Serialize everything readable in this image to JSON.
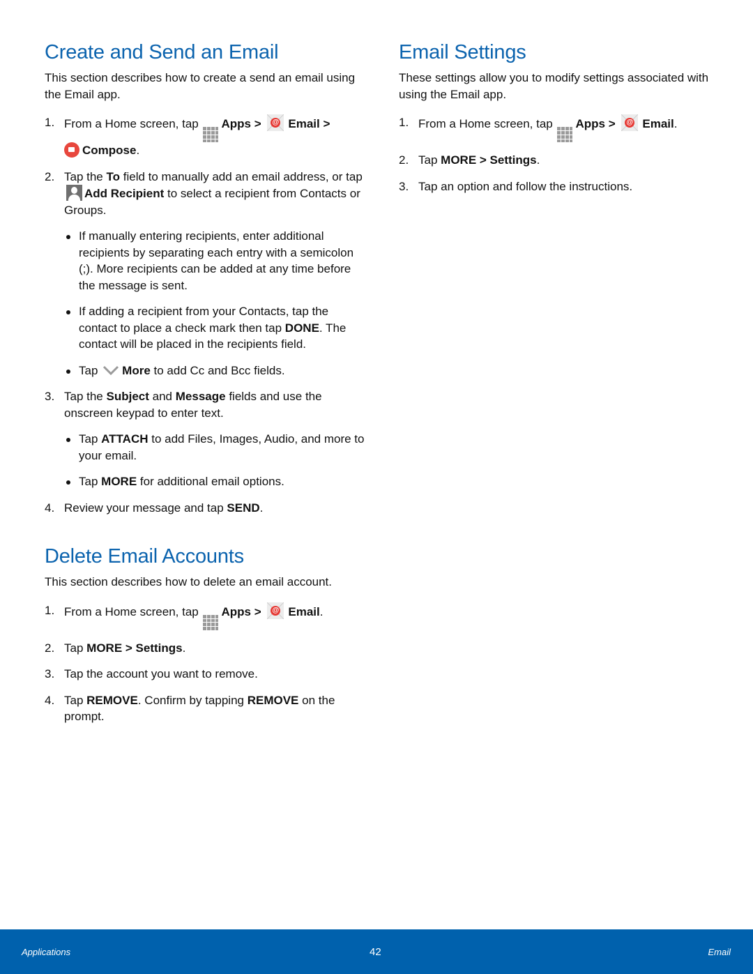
{
  "sections": {
    "create": {
      "title": "Create and Send an Email",
      "intro": "This section describes how to create a send an email using the Email app.",
      "step1": {
        "num": "1.",
        "pre": "From a Home screen, tap",
        "apps": "Apps",
        "sep1": ">",
        "email": "Email",
        "sep2": ">",
        "compose": "Compose",
        "end": "."
      },
      "step2": {
        "num": "2.",
        "t1": "Tap the",
        "to": "To",
        "t2": "field to manually add an email address, or tap",
        "add": "Add Recipient",
        "t3": "to select a recipient from Contacts or Groups."
      },
      "bullet1": "If manually entering recipients, enter additional recipients by separating each entry with a semicolon (;). More recipients can be added at any time before the message is sent.",
      "bullet2": {
        "t1": "If adding a recipient from your Contacts, tap the contact to place a check mark then tap",
        "done": "DONE",
        "t2": ". The contact will be placed in the recipients field."
      },
      "bullet3": {
        "t1": "Tap",
        "more": "More",
        "t2": "to add Cc and Bcc fields."
      },
      "step3": {
        "num": "3.",
        "t1": "Tap the",
        "subject": "Subject",
        "t2": "and",
        "message": "Message",
        "t3": "fields and use the onscreen keypad to enter text."
      },
      "bullet4": {
        "t1": "Tap",
        "attach": "ATTACH",
        "t2": "to add Files, Images, Audio, and more to your email."
      },
      "bullet5": {
        "t1": "Tap",
        "more": "MORE",
        "t2": "for additional email options."
      },
      "step4": {
        "num": "4.",
        "t1": "Review your message and tap",
        "send": "SEND",
        "end": "."
      }
    },
    "delete": {
      "title": "Delete Email Accounts",
      "intro": "This section describes how to delete an email account.",
      "step1": {
        "num": "1.",
        "pre": "From a Home screen, tap",
        "apps": "Apps",
        "sep1": ">",
        "email": "Email",
        "end": "."
      },
      "step2": {
        "num": "2.",
        "t1": "Tap",
        "path": "MORE > Settings",
        "end": "."
      },
      "step3": {
        "num": "3.",
        "t1": "Tap the account you want to remove."
      },
      "step4": {
        "num": "4.",
        "t1": "Tap",
        "remove1": "REMOVE",
        "t2": ". Confirm by tapping",
        "remove2": "REMOVE",
        "t3": "on the prompt."
      }
    },
    "settings": {
      "title": "Email Settings",
      "intro": "These settings allow you to modify settings associated with using the Email app.",
      "step1": {
        "num": "1.",
        "pre": "From a Home screen, tap",
        "apps": "Apps",
        "sep1": ">",
        "email": "Email",
        "end": "."
      },
      "step2": {
        "num": "2.",
        "t1": "Tap",
        "path": "MORE > Settings",
        "end": "."
      },
      "step3": {
        "num": "3.",
        "t1": "Tap an option and follow the instructions."
      }
    }
  },
  "icons": {
    "apps": "apps-grid-icon",
    "email": "email-app-icon",
    "compose": "compose-icon",
    "add_recipient": "person-icon",
    "more": "chevron-down-icon"
  },
  "footer": {
    "left": "Applications",
    "page": "42",
    "right": "Email"
  },
  "colors": {
    "heading": "#0b63ae",
    "footer_bg": "#0061ad"
  }
}
